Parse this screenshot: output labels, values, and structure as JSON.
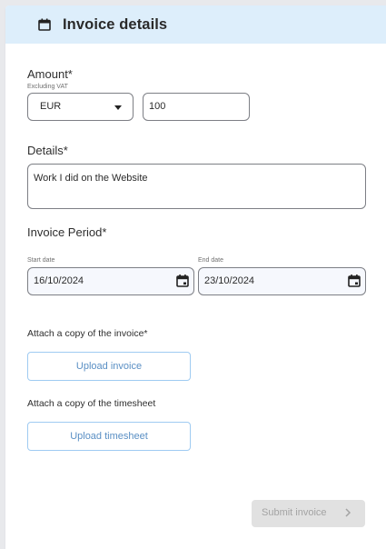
{
  "header": {
    "title": "Invoice details",
    "icon": "calendar-icon"
  },
  "amount": {
    "label": "Amount*",
    "sublabel": "Excluding VAT",
    "currency": "EUR",
    "value": "100"
  },
  "details": {
    "label": "Details*",
    "value": "Work I did on the Website"
  },
  "period": {
    "label": "Invoice Period*",
    "start_label": "Start date",
    "start_value": "16/10/2024",
    "end_label": "End date",
    "end_value": "23/10/2024"
  },
  "invoice_upload": {
    "label": "Attach a copy of the invoice*",
    "button": "Upload invoice"
  },
  "timesheet_upload": {
    "label": "Attach a copy of the timesheet",
    "button": "Upload timesheet"
  },
  "submit": {
    "label": "Submit invoice",
    "disabled": true
  },
  "colors": {
    "header_bg": "#ddeefb",
    "upload_border": "#9fcbf2",
    "upload_text": "#5a8fc4",
    "submit_bg": "#e1e1e1",
    "submit_text": "#a3a3a3"
  }
}
